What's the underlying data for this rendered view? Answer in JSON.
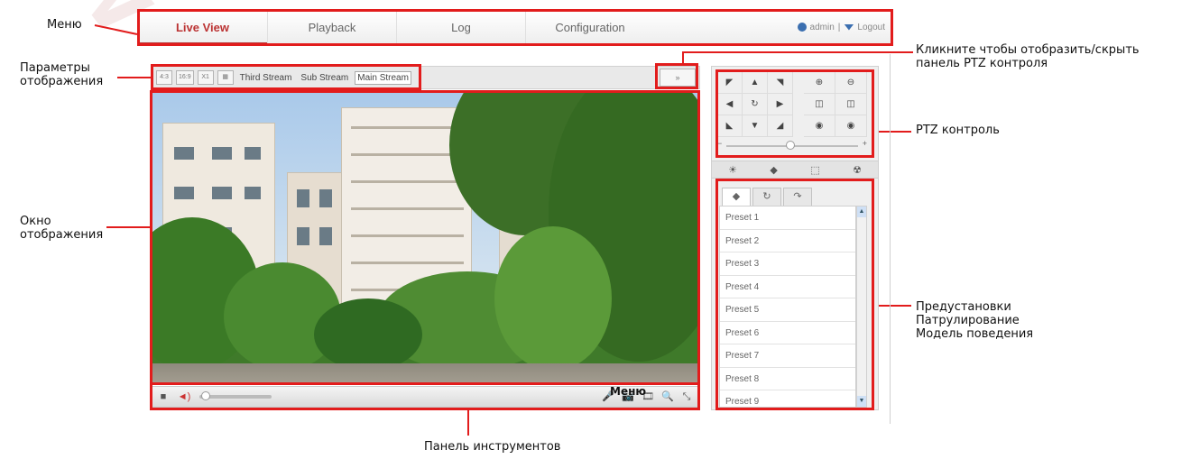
{
  "annotations": {
    "menu": "Меню",
    "display_params": "Параметры\nотображения",
    "display_window": "Окно\nотображения",
    "ptz_toggle": "Кликните чтобы отобразить/скрыть\nпанель PTZ контроля",
    "ptz_control": "PTZ контроль",
    "presets": "Предустановки\nПатрулирование\nМодель поведения",
    "toolbar": "Панель инструментов",
    "menu_overlap": "Меню"
  },
  "menu": {
    "tabs": [
      "Live View",
      "Playback",
      "Log",
      "Configuration"
    ],
    "active_tab": "Live View",
    "user": "admin",
    "separator": "|",
    "logout": "Logout"
  },
  "display_bar": {
    "buttons": [
      "4:3",
      "16:9",
      "X1",
      "▦"
    ],
    "streams": [
      "Third Stream",
      "Sub Stream",
      "Main Stream"
    ],
    "selected_stream": "Main Stream",
    "ptz_toggle_label": "»"
  },
  "ptz": {
    "direction_icons": [
      "◤",
      "▲",
      "◥",
      "◀",
      "↻",
      "▶",
      "◣",
      "▼",
      "◢"
    ],
    "lens_icons": [
      "⊕",
      "⊖",
      "◫",
      "◫",
      "◉",
      "◉"
    ],
    "speed_minus": "−",
    "speed_plus": "+",
    "function_icons": [
      "☀",
      "◆",
      "⬚",
      "☢"
    ]
  },
  "preset_tabs": [
    "◆",
    "↻",
    "↷"
  ],
  "presets": [
    "Preset 1",
    "Preset 2",
    "Preset 3",
    "Preset 4",
    "Preset 5",
    "Preset 6",
    "Preset 7",
    "Preset 8",
    "Preset 9"
  ],
  "toolbar": {
    "stop_icon": "■",
    "volume_icon": "◄)",
    "volume": 0.05,
    "right_icons": [
      "🎤",
      "📷",
      "🎞",
      "🔍",
      "⤡"
    ]
  },
  "colors": {
    "annotation_red": "#e21c1c",
    "active_tab": "#bb3333"
  }
}
